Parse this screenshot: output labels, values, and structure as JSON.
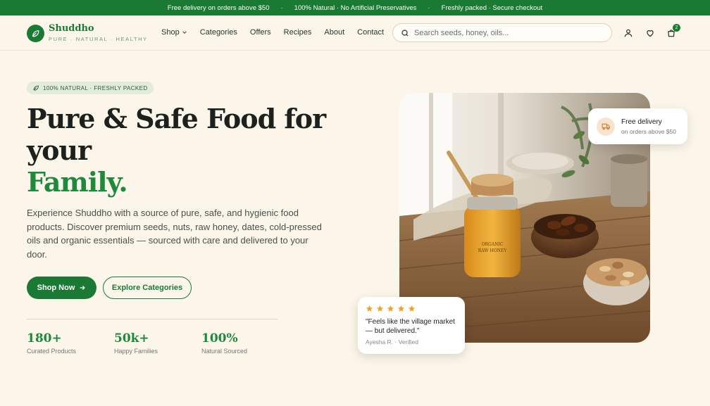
{
  "topbar": {
    "items": [
      "Free delivery on orders above $50",
      "100% Natural · No Artificial Preservatives",
      "Freshly packed · Secure checkout"
    ]
  },
  "brand": {
    "name": "Shuddho",
    "tagline": "PURE · NATURAL · HEALTHY"
  },
  "nav": {
    "shop": "Shop",
    "categories": "Categories",
    "offers": "Offers",
    "recipes": "Recipes",
    "about": "About",
    "contact": "Contact"
  },
  "search": {
    "placeholder": "Search seeds, honey, oils..."
  },
  "cart": {
    "count": "2"
  },
  "hero": {
    "pill": "100% NATURAL · FRESHLY PACKED",
    "headline_line1": "Pure & Safe Food for your",
    "headline_line2": "Family.",
    "description": "Experience Shuddho with a source of pure, safe, and hygienic food products. Discover premium seeds, nuts, raw honey, dates, cold-pressed oils and organic essentials — sourced with care and delivered to your door.",
    "shop_now": "Shop Now",
    "explore": "Explore Categories",
    "jar_label_1": "ORGANIC",
    "jar_label_2": "RAW HONEY"
  },
  "stats": [
    {
      "value": "180+",
      "label": "Curated Products"
    },
    {
      "value": "50k+",
      "label": "Happy Families"
    },
    {
      "value": "100%",
      "label": "Natural Sourced"
    }
  ],
  "delivery_card": {
    "title": "Free delivery",
    "subtitle": "on orders above $50"
  },
  "review_card": {
    "rating": 5,
    "quote": "\"Feels like the village market — but delivered.\"",
    "author": "Ayesha R. · Verified"
  },
  "colors": {
    "brand_green": "#1a7a33",
    "accent_green": "#1f8a3d",
    "background": "#fbf6e9",
    "star": "#f0a22a"
  }
}
